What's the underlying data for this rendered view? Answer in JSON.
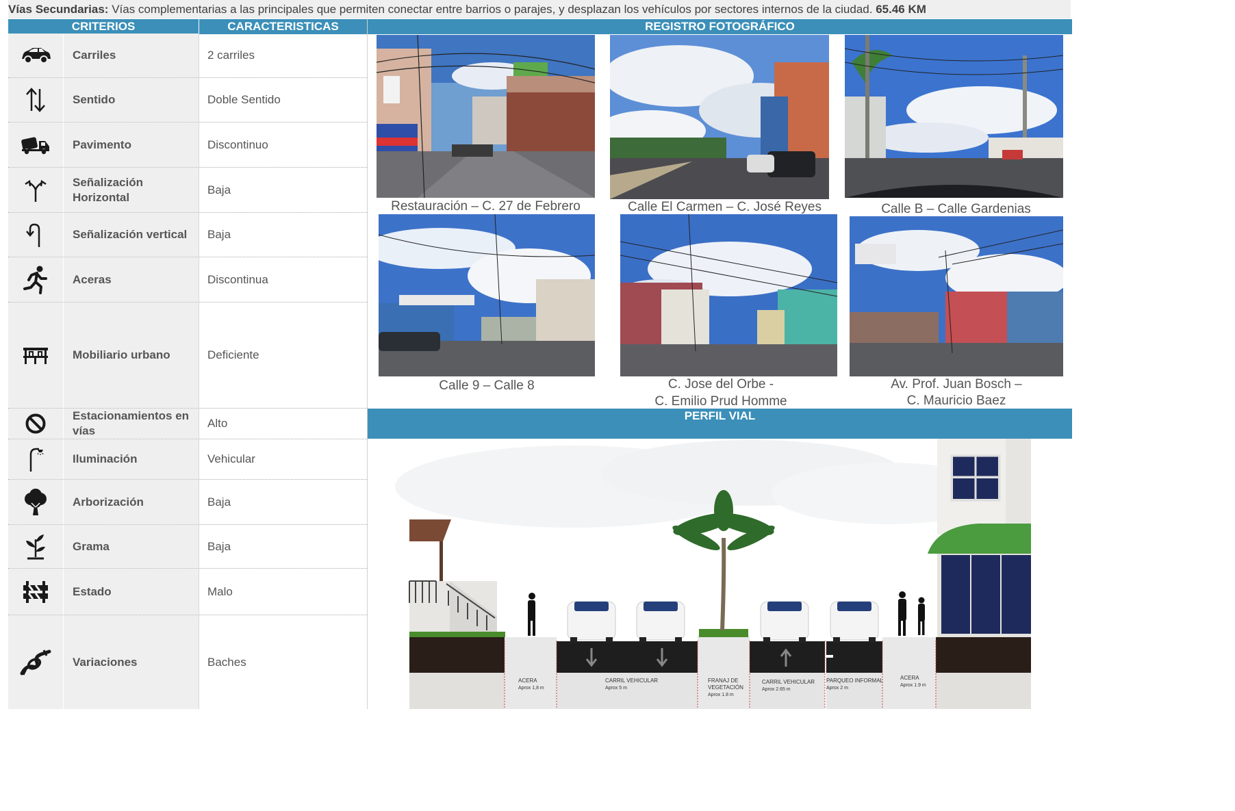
{
  "intro": {
    "title": "Vías Secundarias:",
    "description": " Vías complementarias a las principales que permiten conectar entre barrios o parajes, y desplazan los vehículos por sectores internos de la ciudad. ",
    "length": "65.46 KM"
  },
  "headers": {
    "criterios": "CRITERIOS",
    "caracteristicas": "CARACTERISTICAS",
    "registro": "REGISTRO FOTOGRÁFICO",
    "perfil": "PERFIL VIAL"
  },
  "rows": [
    {
      "icon": "car-icon",
      "criterio": "Carriles",
      "valor": "2 carriles"
    },
    {
      "icon": "two-way-arrows-icon",
      "criterio": "Sentido",
      "valor": "Doble Sentido"
    },
    {
      "icon": "paving-truck-icon",
      "criterio": "Pavimento",
      "valor": "Discontinuo"
    },
    {
      "icon": "road-fork-icon",
      "criterio": "Señalización Horizontal",
      "valor": "Baja"
    },
    {
      "icon": "u-turn-icon",
      "criterio": "Señalización vertical",
      "valor": "Baja"
    },
    {
      "icon": "pedestrian-icon",
      "criterio": "Aceras",
      "valor": "Discontinua"
    },
    {
      "icon": "bench-icon",
      "criterio": "Mobiliario urbano",
      "valor": "Deficiente"
    },
    {
      "icon": "no-parking-icon",
      "criterio": "Estacionamientos en vías",
      "valor": "Alto"
    },
    {
      "icon": "street-lamp-icon",
      "criterio": "Iluminación",
      "valor": "Vehicular"
    },
    {
      "icon": "tree-icon",
      "criterio": "Arborización",
      "valor": "Baja"
    },
    {
      "icon": "sprout-icon",
      "criterio": "Grama",
      "valor": "Baja"
    },
    {
      "icon": "barrier-icon",
      "criterio": "Estado",
      "valor": "Malo"
    },
    {
      "icon": "pothole-icon",
      "criterio": "Variaciones",
      "valor": "Baches"
    }
  ],
  "photos": [
    {
      "caption": "Restauración – C. 27 de Febrero"
    },
    {
      "caption": "Calle El Carmen – C. José Reyes"
    },
    {
      "caption": "Calle B – Calle Gardenias"
    },
    {
      "caption": "Calle 9 – Calle 8"
    },
    {
      "caption_line1": "C. Jose del Orbe -",
      "caption_line2": "C. Emilio Prud Homme"
    },
    {
      "caption_line1": "Av. Prof. Juan Bosch –",
      "caption_line2": "C. Mauricio Baez"
    }
  ],
  "profile_labels": [
    {
      "title": "ACERA",
      "sub": "Aprox 1,8 m"
    },
    {
      "title": "CARRIL VEHICULAR",
      "sub": "Aprox 5 m"
    },
    {
      "title_line1": "FRANAJ DE",
      "title_line2": "VEGETACIÓN",
      "sub": "Aprox 1.8 m"
    },
    {
      "title": "CARRIL VEHICULAR",
      "sub": "Aprox 2.65 m"
    },
    {
      "title": "PARQUEO INFORMAL",
      "sub": "Aprox 2 m"
    },
    {
      "title": "ACERA",
      "sub": "Aprox 1.9 m"
    }
  ],
  "colors": {
    "header_blue": "#3b8fb9",
    "row_gray": "#efefef",
    "road_dark": "#1e1e1e",
    "grass": "#4a8b2c"
  }
}
